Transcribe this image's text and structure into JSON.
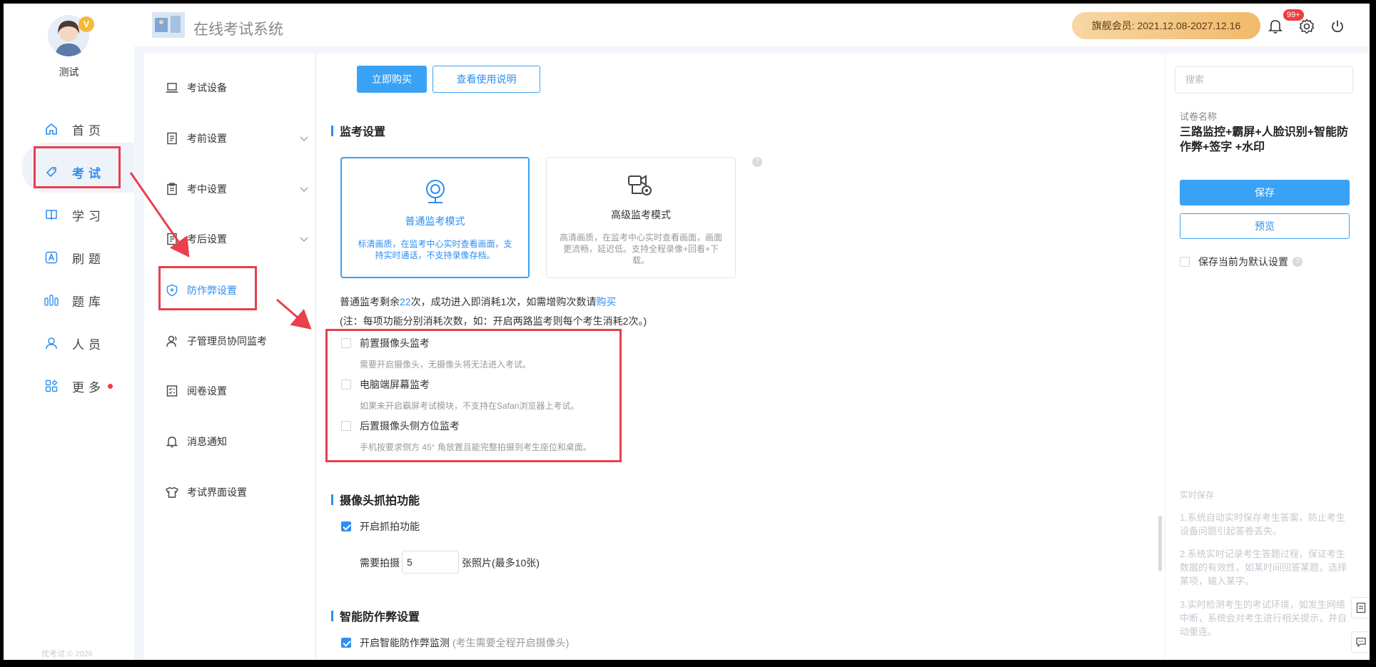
{
  "user": {
    "name": "测试",
    "vip_mark": "V"
  },
  "nav": {
    "items": [
      {
        "label": "首页"
      },
      {
        "label": "考试"
      },
      {
        "label": "学习"
      },
      {
        "label": "刷题"
      },
      {
        "label": "题库"
      },
      {
        "label": "人员"
      },
      {
        "label": "更多"
      }
    ],
    "copyright": "优考试 © 2026"
  },
  "header": {
    "title": "在线考试系统",
    "membership": "旗舰会员:  2021.12.08-2027.12.16",
    "notification_count": "99+"
  },
  "subnav": {
    "items": [
      {
        "label": "考试设备"
      },
      {
        "label": "考前设置"
      },
      {
        "label": "考中设置"
      },
      {
        "label": "考后设置"
      },
      {
        "label": "防作弊设置"
      },
      {
        "label": "子管理员协同监考"
      },
      {
        "label": "阅卷设置"
      },
      {
        "label": "消息通知"
      },
      {
        "label": "考试界面设置"
      }
    ]
  },
  "main": {
    "buy_button": "立即购买",
    "guide_button": "查看使用说明",
    "proctor_section": "监考设置",
    "modes": [
      {
        "title": "普通监考模式",
        "desc": "标清画质，在监考中心实时查看画面，支持实时通话，不支持录像存档。",
        "selected": true
      },
      {
        "title": "高级监考模式",
        "desc": "高清画质，在监考中心实时查看画面，画面更流畅，延迟低。支持全程录像+回看+下载。",
        "selected": false
      }
    ],
    "help_mark": "?",
    "quota": {
      "prefix": "普通监考剩余",
      "count": "22",
      "suffix": "次，成功进入即消耗1次，如需增购次数请",
      "link": "购买"
    },
    "quota_note": "(注：每项功能分别消耗次数，如：开启两路监考则每个考生消耗2次。)",
    "options": [
      {
        "label": "前置摄像头监考",
        "desc": "需要开启摄像头，无摄像头将无法进入考试。",
        "checked": false
      },
      {
        "label": "电脑端屏幕监考",
        "desc": "如果未开启霸屏考试模块，不支持在Safari浏览器上考试。",
        "checked": false
      },
      {
        "label": "后置摄像头侧方位监考",
        "desc": "手机按要求侧方 45° 角放置且能完整拍摄到考生座位和桌面。",
        "checked": false
      }
    ],
    "capture_section": "摄像头抓拍功能",
    "capture_enable": "开启抓拍功能",
    "capture_need": "需要拍摄",
    "capture_count": "5",
    "capture_unit": "张照片(最多10张)",
    "anticheat_section": "智能防作弊设置",
    "anticheat_enable": "开启智能防作弊监测",
    "anticheat_note": "(考生需要全程开启摄像头)"
  },
  "right": {
    "search_placeholder": "搜索",
    "paper_label": "试卷名称",
    "paper_name": "三路监控+霸屏+人脸识别+智能防作弊+签字 +水印",
    "save_button": "保存",
    "preview_button": "预览",
    "default_label": "保存当前为默认设置",
    "help_mark": "?",
    "tips_title": "实时保存",
    "tips": [
      "1.系统自动实时保存考生答案，防止考生设备问题引起答卷丢失。",
      "2.系统实时记录考生答题过程，保证考生数据的有效性，如某时间回答某题，选择某项，输入某字。",
      "3.实时检测考生的考试环境，如发生网络中断，系统会对考生进行相关提示，并自动重连。"
    ]
  },
  "colors": {
    "accent": "#2f8ef0",
    "annotation": "#e8404c",
    "vip_gold": "#f1b96a"
  }
}
